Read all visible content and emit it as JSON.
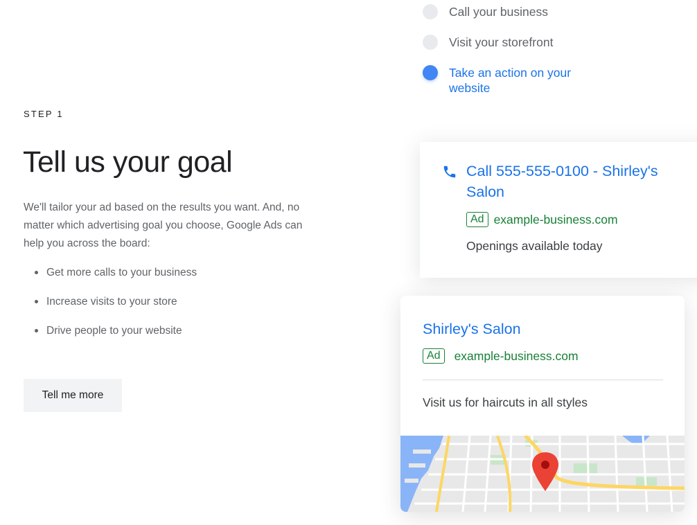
{
  "left": {
    "step_label": "STEP 1",
    "headline": "Tell us your goal",
    "intro": "We'll tailor your ad based on the results you want. And, no matter which advertising goal you choose, Google Ads can help you across the board:",
    "bullets": [
      "Get more calls to your business",
      "Increase visits to your store",
      "Drive people to your website"
    ],
    "cta_label": "Tell me more"
  },
  "goals": [
    {
      "label": "Call your business",
      "selected": false
    },
    {
      "label": "Visit your storefront",
      "selected": false
    },
    {
      "label": "Take an action on your website",
      "selected": true
    }
  ],
  "call_ad": {
    "icon": "phone-icon",
    "headline": "Call 555-555-0100 - Shirley's Salon",
    "badge": "Ad",
    "url": "example-business.com",
    "description": "Openings available today"
  },
  "salon_ad": {
    "title": "Shirley's Salon",
    "badge": "Ad",
    "url": "example-business.com",
    "description": "Visit us for haircuts in all styles",
    "map_icon": "map-pin-icon"
  },
  "colors": {
    "link_blue": "#1a73e8",
    "ad_green": "#188038",
    "radio_selected": "#4285f4",
    "radio_unselected": "#e8eaed",
    "pin_red": "#ea4335"
  }
}
